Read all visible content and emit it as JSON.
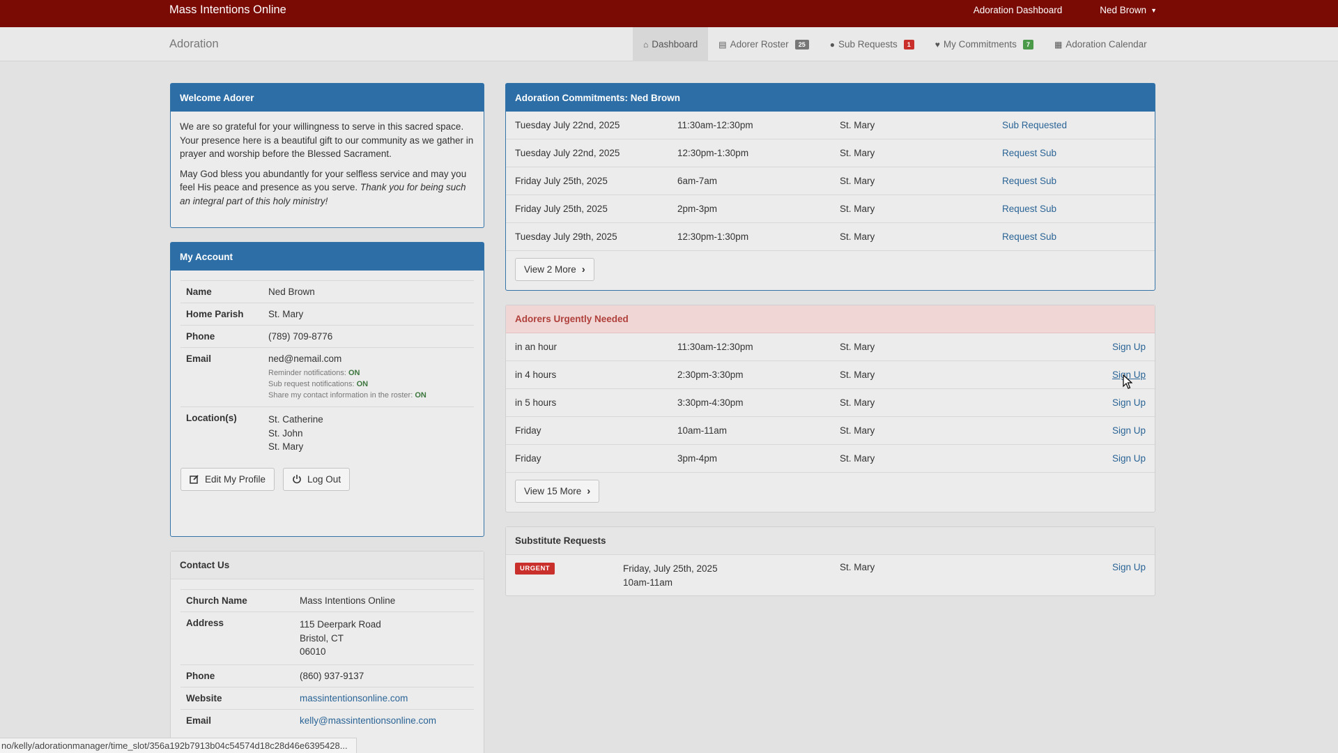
{
  "topbar": {
    "brand": "Mass Intentions Online",
    "dashboard_link": "Adoration Dashboard",
    "user_menu": "Ned Brown",
    "caret": "▼"
  },
  "subnav": {
    "title": "Adoration",
    "items": [
      {
        "label": "Dashboard",
        "icon": "home-icon",
        "glyph": "⌂"
      },
      {
        "label": "Adorer Roster",
        "icon": "list-icon",
        "glyph": "▤",
        "badge": "25"
      },
      {
        "label": "Sub Requests",
        "icon": "exclamation-circle-icon",
        "glyph": "❗",
        "badge": "1"
      },
      {
        "label": "My Commitments",
        "icon": "heart-icon",
        "glyph": "♥",
        "badge": "7"
      },
      {
        "label": "Adoration Calendar",
        "icon": "calendar-icon",
        "glyph": "▦"
      }
    ]
  },
  "welcome": {
    "title": "Welcome Adorer",
    "p1": "We are so grateful for your willingness to serve in this sacred space. Your presence here is a beautiful gift to our community as we gather in prayer and worship before the Blessed Sacrament.",
    "p2": "May God bless you abundantly for your selfless service and may you feel His peace and presence as you serve.",
    "p2_italic": "Thank you for being such an integral part of this holy ministry!"
  },
  "account": {
    "title": "My Account",
    "name_label": "Name",
    "name": "Ned Brown",
    "parish_label": "Home Parish",
    "parish": "St. Mary",
    "phone_label": "Phone",
    "phone": "(789) 709-8776",
    "email_label": "Email",
    "email": "ned@nemail.com",
    "reminder_label": "Reminder notifications:",
    "reminder_value": "ON",
    "subreq_label": "Sub request notifications:",
    "subreq_value": "ON",
    "share_label": "Share my contact information in the roster:",
    "share_value": "ON",
    "locations_label": "Location(s)",
    "locations": [
      "St. Catherine",
      "St. John",
      "St. Mary"
    ],
    "edit_button": "Edit My Profile",
    "logout_button": "Log Out"
  },
  "contact": {
    "title": "Contact Us",
    "church_label": "Church Name",
    "church": "Mass Intentions Online",
    "address_label": "Address",
    "address": [
      "115 Deerpark Road",
      "Bristol, CT",
      "06010"
    ],
    "phone_label": "Phone",
    "phone": "(860) 937-9137",
    "website_label": "Website",
    "website": "massintentionsonline.com",
    "email_label": "Email",
    "email": "kelly@massintentionsonline.com"
  },
  "commitments": {
    "title": "Adoration Commitments: Ned Brown",
    "rows": [
      {
        "date": "Tuesday July 22nd, 2025",
        "time": "11:30am-12:30pm",
        "location": "St. Mary",
        "action": "Sub Requested"
      },
      {
        "date": "Tuesday July 22nd, 2025",
        "time": "12:30pm-1:30pm",
        "location": "St. Mary",
        "action": "Request Sub"
      },
      {
        "date": "Friday July 25th, 2025",
        "time": "6am-7am",
        "location": "St. Mary",
        "action": "Request Sub"
      },
      {
        "date": "Friday July 25th, 2025",
        "time": "2pm-3pm",
        "location": "St. Mary",
        "action": "Request Sub"
      },
      {
        "date": "Tuesday July 29th, 2025",
        "time": "12:30pm-1:30pm",
        "location": "St. Mary",
        "action": "Request Sub"
      }
    ],
    "more_button": "View 2 More"
  },
  "urgent": {
    "title": "Adorers Urgently Needed",
    "rows": [
      {
        "when": "in an hour",
        "time": "11:30am-12:30pm",
        "location": "St. Mary",
        "action": "Sign Up"
      },
      {
        "when": "in 4 hours",
        "time": "2:30pm-3:30pm",
        "location": "St. Mary",
        "action": "Sign Up"
      },
      {
        "when": "in 5 hours",
        "time": "3:30pm-4:30pm",
        "location": "St. Mary",
        "action": "Sign Up"
      },
      {
        "when": "Friday",
        "time": "10am-11am",
        "location": "St. Mary",
        "action": "Sign Up"
      },
      {
        "when": "Friday",
        "time": "3pm-4pm",
        "location": "St. Mary",
        "action": "Sign Up"
      }
    ],
    "more_button": "View 15 More"
  },
  "substitutes": {
    "title": "Substitute Requests",
    "rows": [
      {
        "badge": "URGENT",
        "date": "Friday, July 25th, 2025",
        "time": "10am-11am",
        "location": "St. Mary",
        "action": "Sign Up"
      }
    ]
  },
  "statusbar": {
    "url": "no/kelly/adorationmanager/time_slot/356a192b7913b04c54574d18c28d46e6395428..."
  },
  "colors": {
    "topbar": "#7a0a04",
    "primary": "#2d6ea6",
    "danger_bg": "#f0d6d5",
    "link": "#2a6496"
  }
}
